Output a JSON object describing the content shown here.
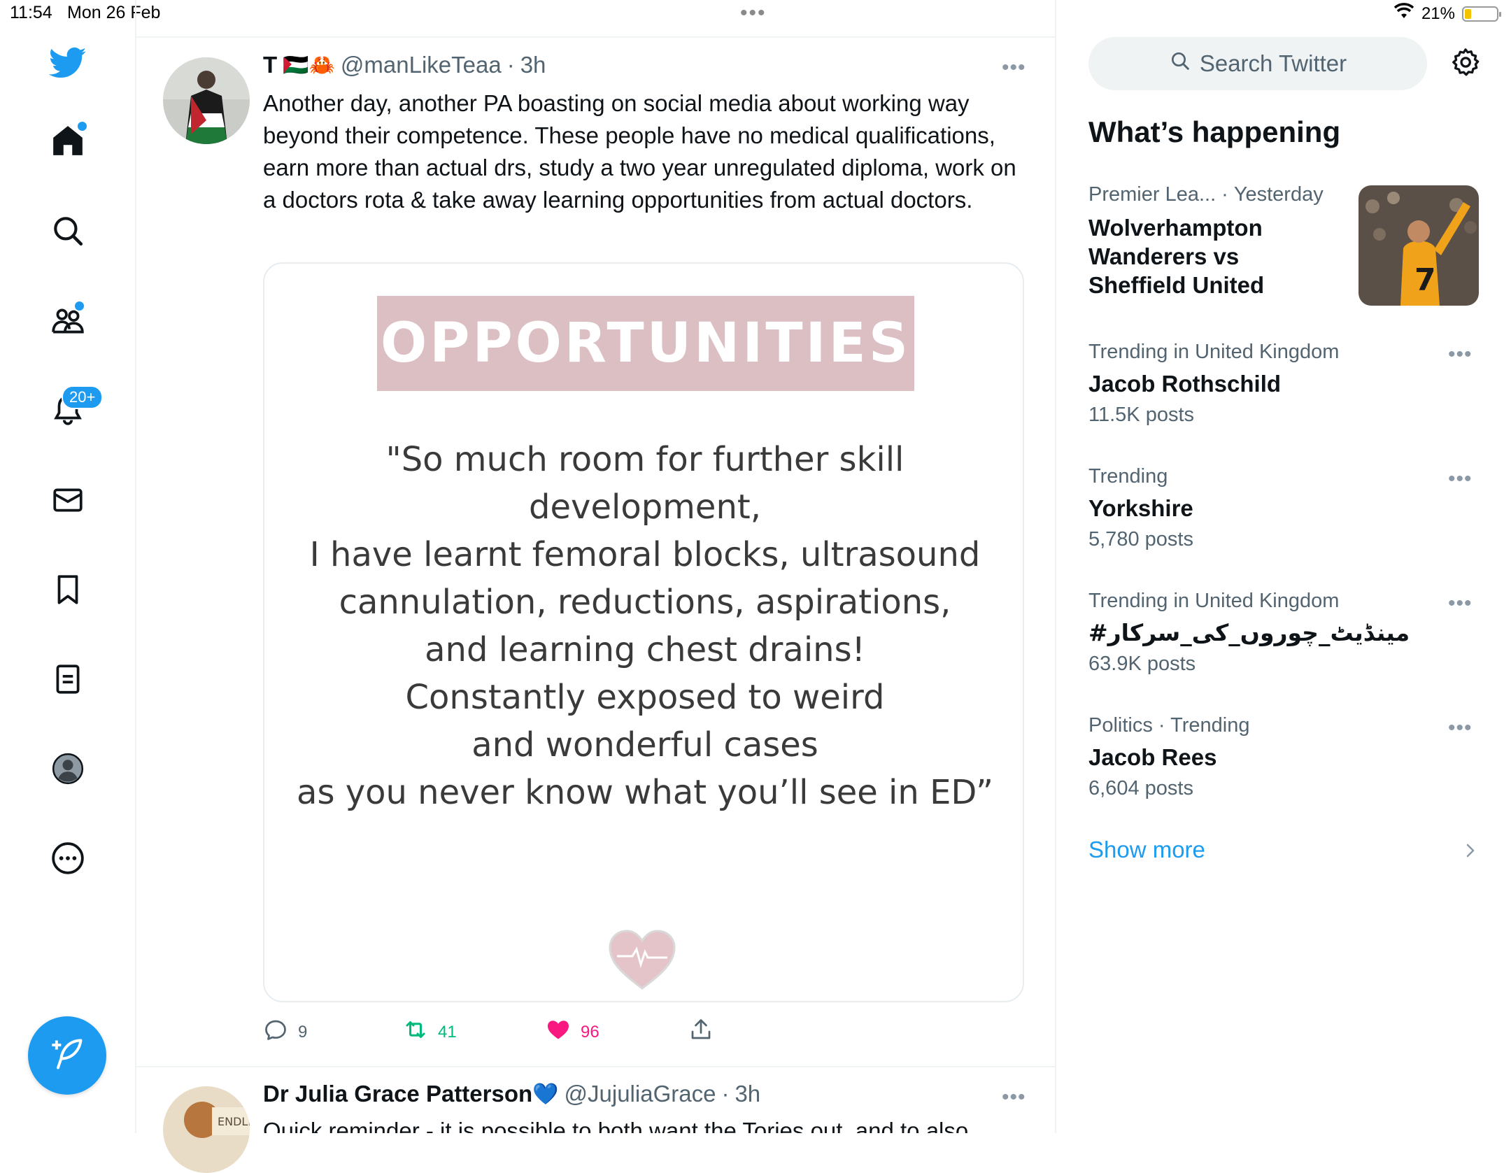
{
  "status_bar": {
    "time": "11:54",
    "date": "Mon 26 Feb",
    "battery": "21%",
    "battery_level": 0.21,
    "top_handle": "•••"
  },
  "nav": {
    "items": [
      {
        "name": "home",
        "icon": "home-icon"
      },
      {
        "name": "explore",
        "icon": "search-icon"
      },
      {
        "name": "communities",
        "icon": "communities-icon"
      },
      {
        "name": "notifications",
        "icon": "bell-icon",
        "badge": "20+"
      },
      {
        "name": "messages",
        "icon": "envelope-icon"
      },
      {
        "name": "bookmarks",
        "icon": "bookmark-icon"
      },
      {
        "name": "lists",
        "icon": "list-icon"
      },
      {
        "name": "profile",
        "icon": "profile-icon"
      },
      {
        "name": "more",
        "icon": "more-icon"
      }
    ],
    "compose_icon": "feather-plus-icon"
  },
  "tweets": [
    {
      "name": "T",
      "flags": "🇵🇸🦀",
      "handle": "@manLikeTeaa",
      "time": "3h",
      "text": "Another day, another PA boasting on social media about working way beyond their competence. These people have no medical qualifications, earn more than actual drs, study a two year unregulated diploma, work on a doctors rota & take away learning opportunities from actual doctors.",
      "media": {
        "title": "OPPORTUNITIES",
        "quote_lines": [
          "\"So much room for further skill",
          "development,",
          "I have learnt femoral blocks, ultrasound",
          "cannulation, reductions, aspirations,",
          "and learning chest drains!",
          "Constantly exposed to weird",
          "and wonderful cases",
          "as you never know what you’ll see in ED”"
        ]
      },
      "actions": {
        "replies": "9",
        "retweets": "41",
        "likes": "96"
      }
    },
    {
      "name": "Dr Julia Grace Patterson",
      "heart": "💙",
      "handle": "@JujuliaGrace",
      "time": "3h",
      "text": "Quick reminder - it is possible to both want the Tories out, and to also"
    }
  ],
  "sidebar": {
    "search_placeholder": "Search Twitter",
    "section_title": "What’s happening",
    "featured": {
      "context": "Premier Lea...",
      "when": "Yesterday",
      "title_lines": [
        "Wolverhampton",
        "Wanderers vs",
        "Sheffield United"
      ]
    },
    "trends": [
      {
        "context": "Trending in United Kingdom",
        "title": "Jacob Rothschild",
        "count": "11.5K posts"
      },
      {
        "context": "Trending",
        "title": "Yorkshire",
        "count": "5,780 posts"
      },
      {
        "context": "Trending in United Kingdom",
        "title": "#مینڈیٹ_چوروں_کی_سرکار",
        "count": "63.9K posts"
      },
      {
        "context": "Politics · Trending",
        "title": "Jacob Rees",
        "count": "6,604 posts"
      }
    ],
    "show_more": "Show more"
  },
  "colors": {
    "accent": "#1d9bf0",
    "retweet": "#00ba7c",
    "like": "#f91880",
    "text_secondary": "#536471"
  }
}
